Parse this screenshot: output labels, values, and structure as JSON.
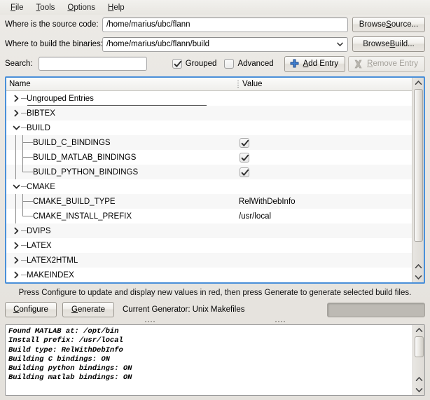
{
  "menu": {
    "items": [
      {
        "pre": "",
        "mn": "F",
        "post": "ile"
      },
      {
        "pre": "",
        "mn": "T",
        "post": "ools"
      },
      {
        "pre": "",
        "mn": "O",
        "post": "ptions"
      },
      {
        "pre": "",
        "mn": "H",
        "post": "elp"
      }
    ]
  },
  "paths": {
    "source_label": "Where is the source code:",
    "source_value": "/home/marius/ubc/flann",
    "browse_source": {
      "pre": "Browse ",
      "mn": "S",
      "post": "ource..."
    },
    "build_label": "Where to build the binaries:",
    "build_value": "/home/marius/ubc/flann/build",
    "browse_build": {
      "pre": "Browse ",
      "mn": "B",
      "post": "uild..."
    }
  },
  "toolbar": {
    "search_label": "Search:",
    "search_value": "",
    "search_placeholder": "",
    "grouped_label": "Grouped",
    "grouped_checked": true,
    "advanced_label": "Advanced",
    "advanced_checked": false,
    "add_entry": {
      "pre": "",
      "mn": "A",
      "post": "dd Entry"
    },
    "remove_entry": {
      "pre": "",
      "mn": "R",
      "post": "emove Entry"
    },
    "remove_entry_disabled": true,
    "add_icon": "plus-icon",
    "remove_icon": "x-icon"
  },
  "tree": {
    "columns": {
      "name": "Name",
      "value": "Value"
    },
    "rows": [
      {
        "label": "Ungrouped Entries",
        "type": "group",
        "expanded": false,
        "value": "",
        "underline": true
      },
      {
        "label": "BIBTEX",
        "type": "group",
        "expanded": false,
        "value": ""
      },
      {
        "label": "BUILD",
        "type": "group",
        "expanded": true,
        "value": ""
      },
      {
        "label": "BUILD_C_BINDINGS",
        "type": "entry",
        "value_type": "checkbox",
        "checked": true,
        "value": ""
      },
      {
        "label": "BUILD_MATLAB_BINDINGS",
        "type": "entry",
        "value_type": "checkbox",
        "checked": true,
        "value": ""
      },
      {
        "label": "BUILD_PYTHON_BINDINGS",
        "type": "entry",
        "value_type": "checkbox",
        "checked": true,
        "value": "",
        "last": true
      },
      {
        "label": "CMAKE",
        "type": "group",
        "expanded": true,
        "value": ""
      },
      {
        "label": "CMAKE_BUILD_TYPE",
        "type": "entry",
        "value_type": "text",
        "value": "RelWithDebInfo"
      },
      {
        "label": "CMAKE_INSTALL_PREFIX",
        "type": "entry",
        "value_type": "text",
        "value": "/usr/local",
        "last": true
      },
      {
        "label": "DVIPS",
        "type": "group",
        "expanded": false,
        "value": ""
      },
      {
        "label": "LATEX",
        "type": "group",
        "expanded": false,
        "value": ""
      },
      {
        "label": "LATEX2HTML",
        "type": "group",
        "expanded": false,
        "value": ""
      },
      {
        "label": "MAKEINDEX",
        "type": "group",
        "expanded": false,
        "value": ""
      }
    ]
  },
  "hint": "Press Configure to update and display new values in red, then press Generate to generate selected build files.",
  "actions": {
    "configure": {
      "pre": "",
      "mn": "C",
      "post": "onfigure"
    },
    "generate": {
      "pre": "",
      "mn": "G",
      "post": "enerate"
    },
    "generator_label": "Current Generator: Unix Makefiles",
    "progress_value": 0
  },
  "log": {
    "lines": [
      "Found MATLAB at: /opt/bin",
      "Install prefix: /usr/local",
      "Build type: RelWithDebInfo",
      "Building C bindings: ON",
      "Building python bindings: ON",
      "Building matlab bindings: ON"
    ]
  },
  "colors": {
    "focus_border": "#4a90d9",
    "window_bg": "#e8e6e1",
    "row_alt": "#f7f7f7",
    "add_icon_blue": "#2a5db0"
  }
}
